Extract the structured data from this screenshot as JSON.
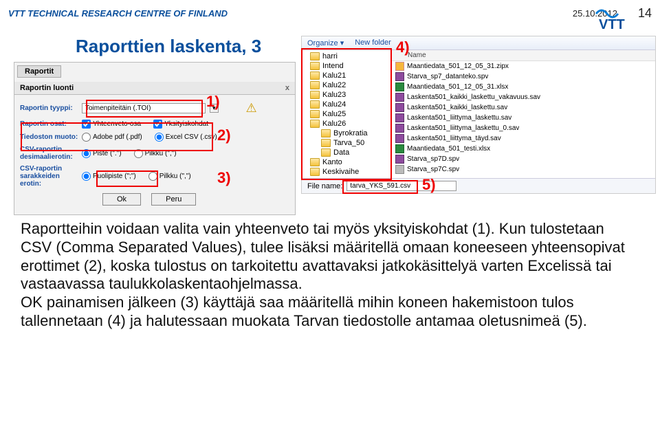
{
  "header": {
    "org": "VTT TECHNICAL RESEARCH CENTRE OF FINLAND",
    "date": "25.10.2012",
    "page": "14",
    "logo_text": "VTT"
  },
  "slide_title": "Raporttien laskenta, 3",
  "markers": {
    "m1": "1)",
    "m2": "2)",
    "m3": "3)",
    "m4": "4)",
    "m5": "5)"
  },
  "dialog": {
    "tab": "Raportit",
    "title": "Raportin luonti",
    "close": "x",
    "type_label": "Raportin tyyppi:",
    "type_value": "Toimenpiteitäin (.TOI)",
    "parts_label": "Raportin osat:",
    "cb1": "Yhteenveto-osa",
    "cb2": "Yksityiskohdat",
    "format_label": "Tiedoston muoto:",
    "fmt1": "Adobe pdf (.pdf)",
    "fmt2": "Excel CSV (.csv)",
    "dec_label": "CSV-raportin desimaalierotin:",
    "dec1": "Piste (\".\")",
    "dec2": "Pilkku (\",\")",
    "col_label": "CSV-raportin sarakkeiden erotin:",
    "col1": "Puolipiste (\";\")",
    "col2": "Pilkku (\",\")",
    "ok": "Ok",
    "cancel": "Peru"
  },
  "explorer": {
    "organize": "Organize ▾",
    "newfolder": "New folder",
    "name_col": "Name",
    "footer_label": "File name:",
    "filename": "tarva_YKS_591.csv",
    "folders": [
      {
        "name": "harri",
        "indent": false
      },
      {
        "name": "Intend",
        "indent": false
      },
      {
        "name": "Kalu21",
        "indent": false
      },
      {
        "name": "Kalu22",
        "indent": false
      },
      {
        "name": "Kalu23",
        "indent": false
      },
      {
        "name": "Kalu24",
        "indent": false
      },
      {
        "name": "Kalu25",
        "indent": false
      },
      {
        "name": "Kalu26",
        "indent": false
      },
      {
        "name": "Byrokratia",
        "indent": true
      },
      {
        "name": "Tarva_50",
        "indent": true
      },
      {
        "name": "Data",
        "indent": true
      },
      {
        "name": "Kanto",
        "indent": false
      },
      {
        "name": "Keskivaihe",
        "indent": false
      }
    ],
    "files": [
      {
        "name": "Maantiedata_501_12_05_31.zipx",
        "type": "zip"
      },
      {
        "name": "Starva_sp7_datanteko.spv",
        "type": "sav"
      },
      {
        "name": "Maantiedata_501_12_05_31.xlsx",
        "type": "xlsx"
      },
      {
        "name": "Laskenta501_kaikki_laskettu_vakavuus.sav",
        "type": "sav"
      },
      {
        "name": "Laskenta501_kaikki_laskettu.sav",
        "type": "sav"
      },
      {
        "name": "Laskenta501_liittyma_laskettu.sav",
        "type": "sav"
      },
      {
        "name": "Laskenta501_liittyma_laskettu_0.sav",
        "type": "sav"
      },
      {
        "name": "Laskenta501_liittyma_täyd.sav",
        "type": "sav"
      },
      {
        "name": "Maantiedata_501_testi.xlsx",
        "type": "xlsx"
      },
      {
        "name": "Starva_sp7D.spv",
        "type": "sav"
      },
      {
        "name": "Starva_sp7C.spv",
        "type": "generic"
      }
    ]
  },
  "body_text": "Raportteihin voidaan valita vain yhteenveto tai myös yksityiskohdat (1). Kun tulostetaan CSV (Comma Separated Values), tulee lisäksi määritellä omaan koneeseen yhteensopivat erottimet (2), koska tulostus on tarkoitettu avattavaksi jatkokäsittelyä varten Excelissä tai vastaavassa taulukkolaskentaohjelmassa.\nOK painamisen jälkeen (3) käyttäjä saa määritellä mihin koneen hakemistoon tulos tallennetaan (4) ja halutessaan muokata Tarvan tiedostolle antamaa oletusnimeä (5)."
}
